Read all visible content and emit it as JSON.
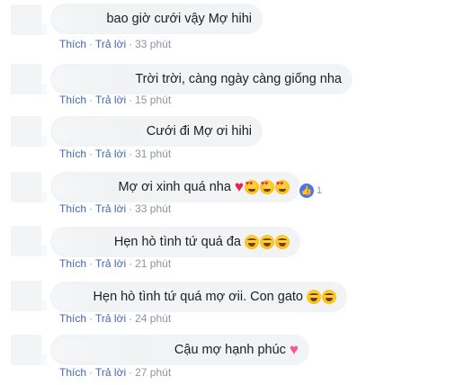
{
  "actions": {
    "like_label": "Thích",
    "reply_label": "Trả lời"
  },
  "comments": [
    {
      "text": "bao giờ cưới vậy Mợ hihi",
      "time": "33 phút",
      "emoji": []
    },
    {
      "text": "Trời trời, càng ngày càng giống nha",
      "time": "15 phút",
      "emoji": []
    },
    {
      "text": "Cưới đi Mợ ơi hihi",
      "time": "31 phút",
      "emoji": []
    },
    {
      "text": "Mợ ơi xinh quá nha",
      "time": "33 phút",
      "emoji": [
        "heart",
        "heart-eyes",
        "heart-eyes",
        "heart-eyes"
      ],
      "reaction_count": "1"
    },
    {
      "text": "Hẹn hò tình tứ quá đa",
      "time": "21 phút",
      "emoji": [
        "laugh",
        "laugh",
        "laugh"
      ]
    },
    {
      "text": "Hẹn hò tình tứ quá mợ ơii. Con gato",
      "time": "24 phút",
      "emoji": [
        "laugh",
        "laugh"
      ]
    },
    {
      "text": "Cậu mợ hạnh phúc",
      "time": "27 phút",
      "emoji": [
        "pink-heart"
      ]
    }
  ],
  "colors": {
    "link": "#4267b2",
    "meta": "#90949c",
    "bubble": "#f2f3f5",
    "like_badge": "#4a76e8"
  }
}
